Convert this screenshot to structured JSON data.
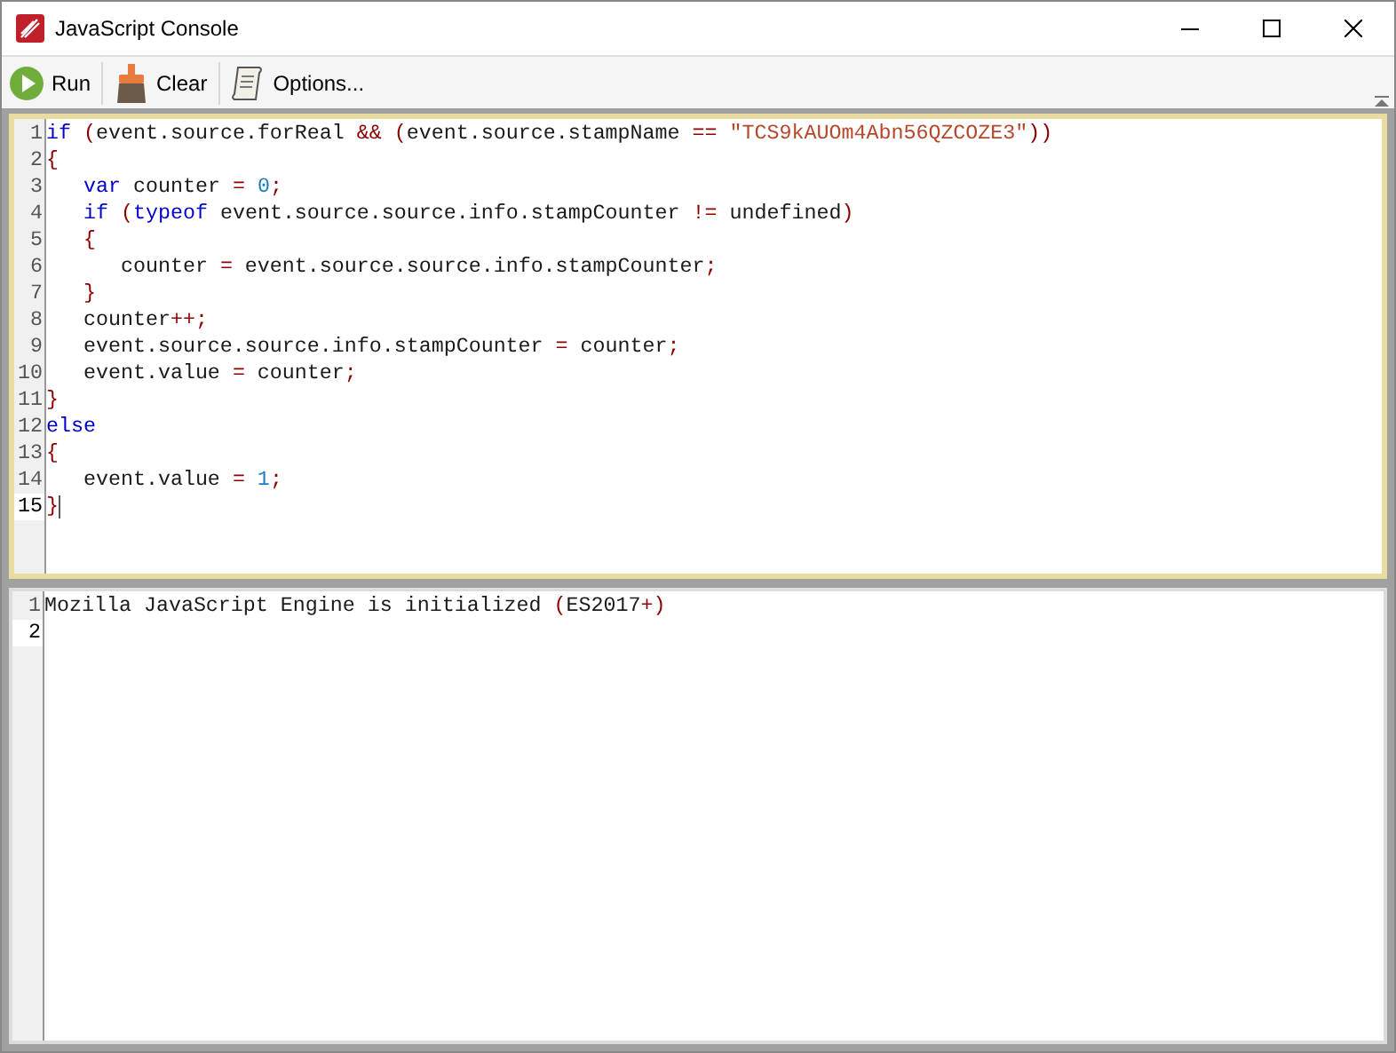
{
  "window": {
    "title": "JavaScript Console"
  },
  "toolbar": [
    {
      "kind": "run",
      "label": "Run"
    },
    {
      "kind": "clear",
      "label": "Clear"
    },
    {
      "kind": "options",
      "label": "Options..."
    }
  ],
  "editor": {
    "lines": [
      {
        "number": "1",
        "current": false,
        "tokens": [
          {
            "kind": "keyword",
            "text": "if"
          },
          {
            "kind": "op",
            "text": " ("
          },
          {
            "kind": "plain",
            "text": "event.source.forReal "
          },
          {
            "kind": "op",
            "text": "&& ("
          },
          {
            "kind": "plain",
            "text": "event.source.stampName "
          },
          {
            "kind": "op",
            "text": "=="
          },
          {
            "kind": "string",
            "text": " \"TCS9kAUOm4Abn56QZCOZE3\""
          },
          {
            "kind": "op",
            "text": "))"
          }
        ]
      },
      {
        "number": "2",
        "current": false,
        "tokens": [
          {
            "kind": "op",
            "text": "{"
          }
        ]
      },
      {
        "number": "3",
        "current": false,
        "tokens": [
          {
            "kind": "keyword",
            "text": "   var"
          },
          {
            "kind": "plain",
            "text": " counter "
          },
          {
            "kind": "op",
            "text": "="
          },
          {
            "kind": "number",
            "text": " 0"
          },
          {
            "kind": "op",
            "text": ";"
          }
        ]
      },
      {
        "number": "4",
        "current": false,
        "tokens": [
          {
            "kind": "keyword",
            "text": "   if"
          },
          {
            "kind": "op",
            "text": " ("
          },
          {
            "kind": "keyword",
            "text": "typeof"
          },
          {
            "kind": "plain",
            "text": " event.source.source.info.stampCounter "
          },
          {
            "kind": "op",
            "text": "!="
          },
          {
            "kind": "plain",
            "text": " undefined"
          },
          {
            "kind": "op",
            "text": ")"
          }
        ]
      },
      {
        "number": "5",
        "current": false,
        "tokens": [
          {
            "kind": "op",
            "text": "   {"
          }
        ]
      },
      {
        "number": "6",
        "current": false,
        "tokens": [
          {
            "kind": "plain",
            "text": "      counter "
          },
          {
            "kind": "op",
            "text": "="
          },
          {
            "kind": "plain",
            "text": " event.source.source.info.stampCounter"
          },
          {
            "kind": "op",
            "text": ";"
          }
        ]
      },
      {
        "number": "7",
        "current": false,
        "tokens": [
          {
            "kind": "op",
            "text": "   }"
          }
        ]
      },
      {
        "number": "8",
        "current": false,
        "tokens": [
          {
            "kind": "plain",
            "text": "   counter"
          },
          {
            "kind": "op",
            "text": "++;"
          }
        ]
      },
      {
        "number": "9",
        "current": false,
        "tokens": [
          {
            "kind": "plain",
            "text": "   event.source.source.info.stampCounter "
          },
          {
            "kind": "op",
            "text": "="
          },
          {
            "kind": "plain",
            "text": " counter"
          },
          {
            "kind": "op",
            "text": ";"
          }
        ]
      },
      {
        "number": "10",
        "current": false,
        "tokens": [
          {
            "kind": "plain",
            "text": "   event.value "
          },
          {
            "kind": "op",
            "text": "="
          },
          {
            "kind": "plain",
            "text": " counter"
          },
          {
            "kind": "op",
            "text": ";"
          }
        ]
      },
      {
        "number": "11",
        "current": false,
        "tokens": [
          {
            "kind": "op",
            "text": "}"
          }
        ]
      },
      {
        "number": "12",
        "current": false,
        "tokens": [
          {
            "kind": "keyword",
            "text": "else"
          }
        ]
      },
      {
        "number": "13",
        "current": false,
        "tokens": [
          {
            "kind": "op",
            "text": "{"
          }
        ]
      },
      {
        "number": "14",
        "current": false,
        "tokens": [
          {
            "kind": "plain",
            "text": "   event.value "
          },
          {
            "kind": "op",
            "text": "="
          },
          {
            "kind": "number",
            "text": " 1"
          },
          {
            "kind": "op",
            "text": ";"
          }
        ]
      },
      {
        "number": "15",
        "current": true,
        "tokens": [
          {
            "kind": "op",
            "text": "}"
          }
        ]
      }
    ]
  },
  "output": {
    "lines": [
      {
        "number": "1",
        "current": false,
        "tokens": [
          {
            "kind": "plain",
            "text": "Mozilla JavaScript Engine is initialized "
          },
          {
            "kind": "op",
            "text": "("
          },
          {
            "kind": "plain",
            "text": "ES2017"
          },
          {
            "kind": "op",
            "text": "+)"
          }
        ]
      },
      {
        "number": "2",
        "current": true
      }
    ]
  }
}
